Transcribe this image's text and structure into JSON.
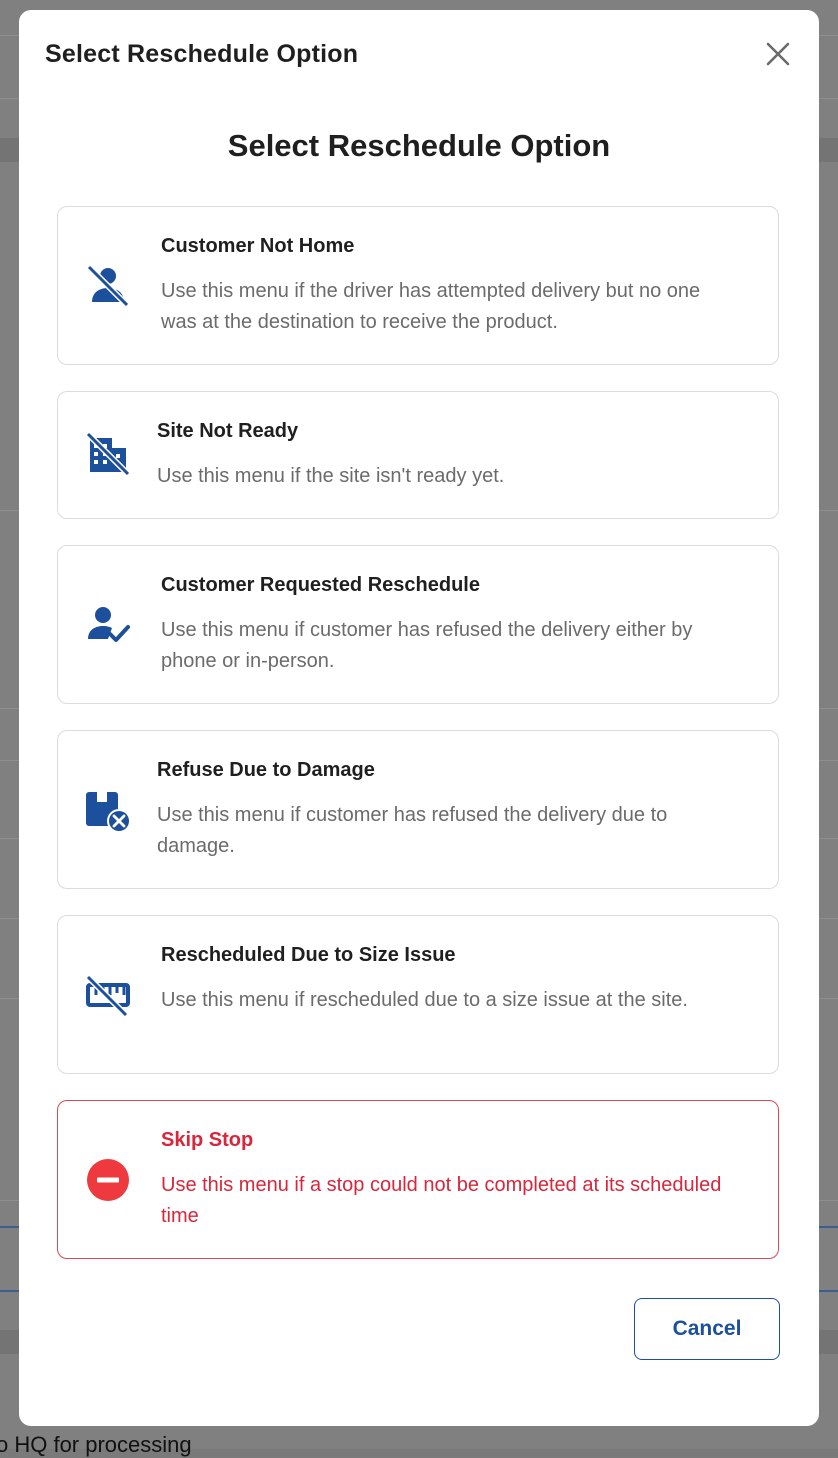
{
  "background": {
    "partial_text": "o HQ for processing"
  },
  "modal": {
    "title": "Select Reschedule Option",
    "close_icon": "close-icon",
    "heading": "Select Reschedule Option"
  },
  "options": [
    {
      "title": "Customer Not Home",
      "description": "Use this menu if the driver has attempted delivery but no one was at the destination to receive the product.",
      "icon": "person-off-icon"
    },
    {
      "title": "Site Not Ready",
      "description": "Use this menu if the site isn't ready yet.",
      "icon": "building-off-icon"
    },
    {
      "title": "Customer Requested Reschedule",
      "description": "Use this menu if customer has refused the delivery either by phone or in-person.",
      "icon": "person-check-icon"
    },
    {
      "title": "Refuse Due to Damage",
      "description": "Use this menu if customer has refused the delivery due to damage.",
      "icon": "package-cancel-icon"
    },
    {
      "title": "Rescheduled Due to Size Issue",
      "description": "Use this menu if rescheduled due to a size issue at the site.",
      "icon": "ruler-off-icon"
    },
    {
      "title": "Skip Stop",
      "description": "Use this menu if a stop could not be completed at its scheduled time",
      "icon": "minus-circle-icon"
    }
  ],
  "footer": {
    "cancel_label": "Cancel"
  },
  "colors": {
    "icon_blue": "#1c4f9c",
    "danger_red": "#d9263b",
    "overlay": "#808080"
  }
}
